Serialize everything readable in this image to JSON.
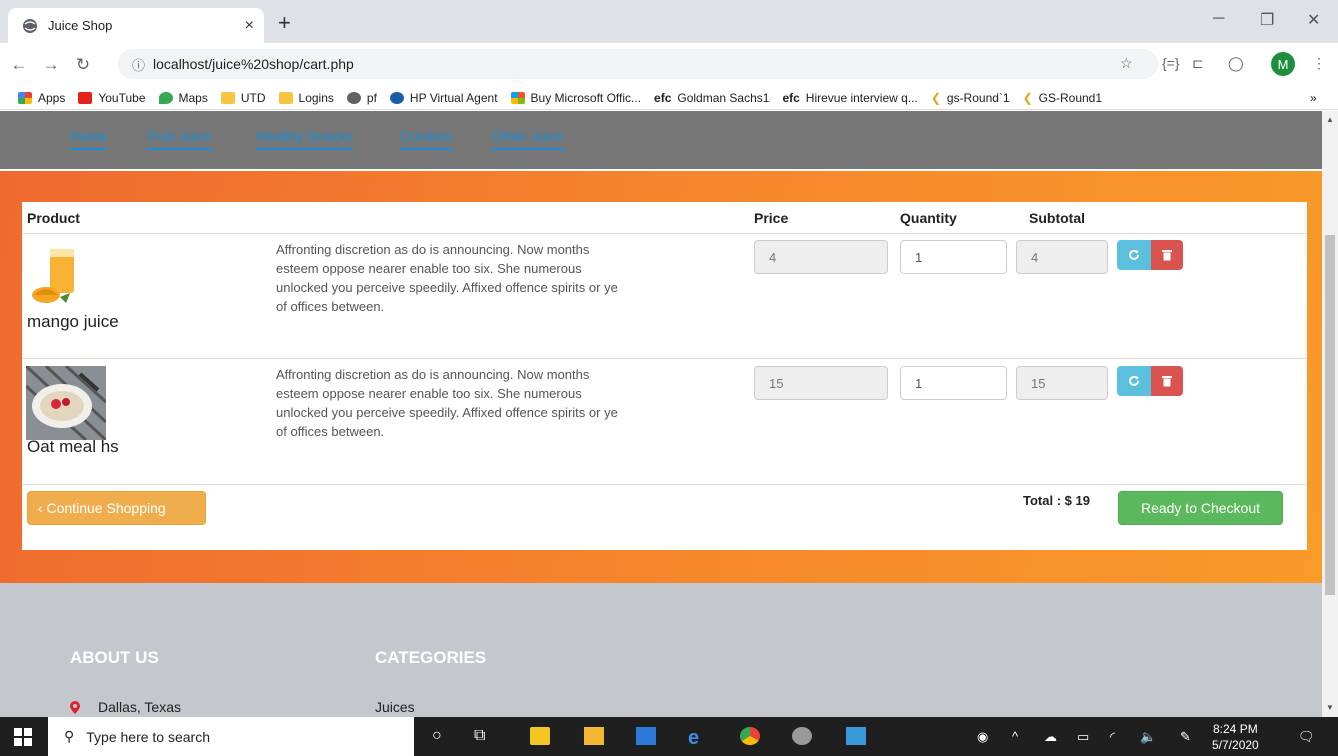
{
  "browser": {
    "tab_title": "Juice Shop",
    "tab_close": "×",
    "new_tab": "+",
    "url": "localhost/juice%20shop/cart.php",
    "profile_initial": "M",
    "bookmarks": [
      "Apps",
      "YouTube",
      "Maps",
      "UTD",
      "Logins",
      "pf",
      "HP Virtual Agent",
      "Buy Microsoft Offic...",
      "Goldman Sachs1",
      "Hirevue interview q...",
      "gs-Round`1",
      "GS-Round1"
    ],
    "bookmarks_more": "»"
  },
  "nav": {
    "links": [
      "Home",
      "Fruit Juice",
      "Healthy Snacks",
      "Combos",
      "Other Juice"
    ]
  },
  "cart": {
    "headers": {
      "product": "Product",
      "price": "Price",
      "quantity": "Quantity",
      "subtotal": "Subtotal"
    },
    "items": [
      {
        "name": "mango juice",
        "description": "Affronting discretion as do is announcing. Now months esteem oppose nearer enable too six. She numerous unlocked you perceive speedily. Affixed offence spirits or ye of offices between.",
        "price": "4",
        "quantity": "1",
        "subtotal": "4"
      },
      {
        "name": "Oat meal hs",
        "description": "Affronting discretion as do is announcing. Now months esteem oppose nearer enable too six. She numerous unlocked you perceive speedily. Affixed offence spirits or ye of offices between.",
        "price": "15",
        "quantity": "1",
        "subtotal": "15"
      }
    ],
    "continue_label": "‹ Continue Shopping",
    "total_label": "Total : $ 19",
    "checkout_label": "Ready to Checkout"
  },
  "footer": {
    "about_title": "ABOUT US",
    "categories_title": "CATEGORIES",
    "location": "Dallas, Texas",
    "category_first": "Juices"
  },
  "taskbar": {
    "search_placeholder": "Type here to search",
    "time": "8:24 PM",
    "date": "5/7/2020"
  },
  "colors": {
    "nav_bg": "#777777",
    "link": "#1a8fd6",
    "orange_start": "#ef6a2f",
    "orange_end": "#f99a29",
    "continue_btn": "#f0ad4e",
    "checkout_btn": "#5cb85c",
    "refresh_btn": "#5bc0de",
    "delete_btn": "#d9534f",
    "footer_bg": "#c4c7cc"
  }
}
